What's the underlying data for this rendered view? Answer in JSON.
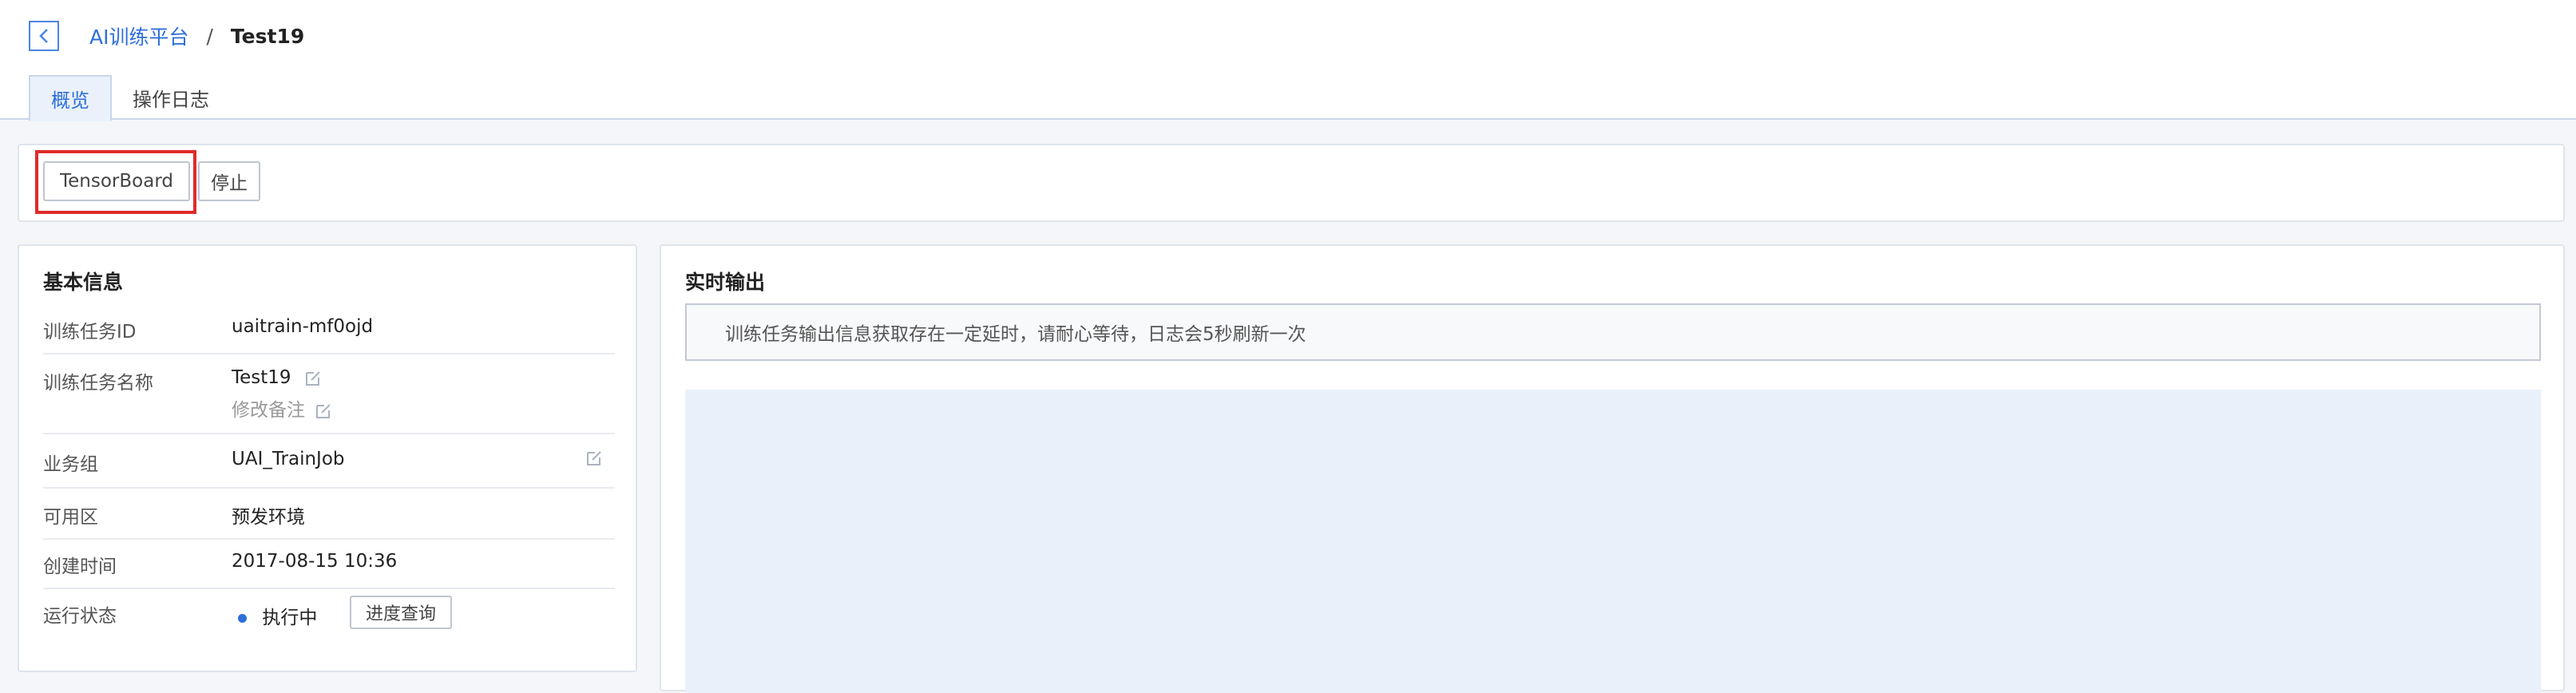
{
  "header": {
    "breadcrumb_parent": "AI训练平台",
    "breadcrumb_sep": "/",
    "breadcrumb_current": "Test19",
    "tabs": [
      {
        "label": "概览",
        "active": true
      },
      {
        "label": "操作日志",
        "active": false
      }
    ]
  },
  "toolbar": {
    "tensorboard_label": "TensorBoard",
    "stop_label": "停止"
  },
  "info": {
    "title": "基本信息",
    "job_id_label": "训练任务ID",
    "job_id_value": "uaitrain-mf0ojd",
    "job_name_label": "训练任务名称",
    "job_name_value": "Test19",
    "remark_label": "修改备注",
    "group_label": "业务组",
    "group_value": "UAI_TrainJob",
    "zone_label": "可用区",
    "zone_value": "预发环境",
    "created_label": "创建时间",
    "created_value": "2017-08-15 10:36",
    "status_label": "运行状态",
    "status_value": "执行中",
    "progress_button": "进度查询"
  },
  "output": {
    "title": "实时输出",
    "notice": "训练任务输出信息获取存在一定延时，请耐心等待，日志会5秒刷新一次"
  },
  "colors": {
    "accent": "#2e6fd9",
    "highlight": "#e02b2b",
    "log_bg": "#e9f0fa"
  }
}
